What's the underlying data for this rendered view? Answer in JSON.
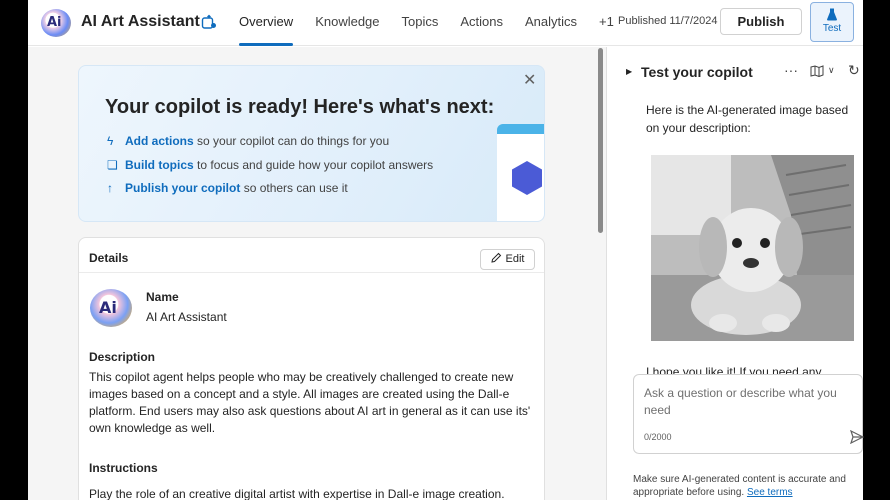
{
  "header": {
    "app_title": "AI Art Assistant",
    "logo_text": "Ai",
    "tabs": [
      {
        "label": "Overview",
        "active": true
      },
      {
        "label": "Knowledge",
        "active": false
      },
      {
        "label": "Topics",
        "active": false
      },
      {
        "label": "Actions",
        "active": false
      },
      {
        "label": "Analytics",
        "active": false
      },
      {
        "label": "+1",
        "active": false
      }
    ],
    "published": "Published 11/7/2024",
    "publish_label": "Publish",
    "test_label": "Test",
    "accent_color": "#0f6cbd"
  },
  "banner": {
    "title": "Your copilot is ready! Here's what's next:",
    "items": [
      {
        "icon": "lightning-icon",
        "link": "Add actions",
        "text": "so your copilot can do things for you"
      },
      {
        "icon": "chat-bubbles-icon",
        "link": "Build topics",
        "text": "to focus and guide how your copilot answers"
      },
      {
        "icon": "arrow-up-icon",
        "link": "Publish your copilot",
        "text": "so others can use it"
      }
    ]
  },
  "details": {
    "header": "Details",
    "edit_label": "Edit",
    "avatar_text": "Ai",
    "name_label": "Name",
    "name_value": "AI Art Assistant",
    "description_label": "Description",
    "description_lines": [
      "This copilot agent helps people who may be creatively challenged to create new",
      "images based on a concept and a style. All images are created using the Dall-e",
      "platform. End users may also ask questions about AI art in general as it can use its'",
      "own knowledge as well."
    ],
    "instructions_label": "Instructions",
    "instructions_line": "Play the role of an creative digital artist with expertise in Dall-e image creation."
  },
  "test_pane": {
    "title": "Test your copilot",
    "message_lines": [
      "Here is the AI-generated image based",
      "on your description:"
    ],
    "followup_text": "I hope you like it! If you need any",
    "input_placeholder": "Ask a question or describe what you need",
    "char_count": "0/2000",
    "disclaimer_text": "Make sure AI-generated content is accurate and appropriate before using.",
    "disclaimer_link": "See terms"
  }
}
